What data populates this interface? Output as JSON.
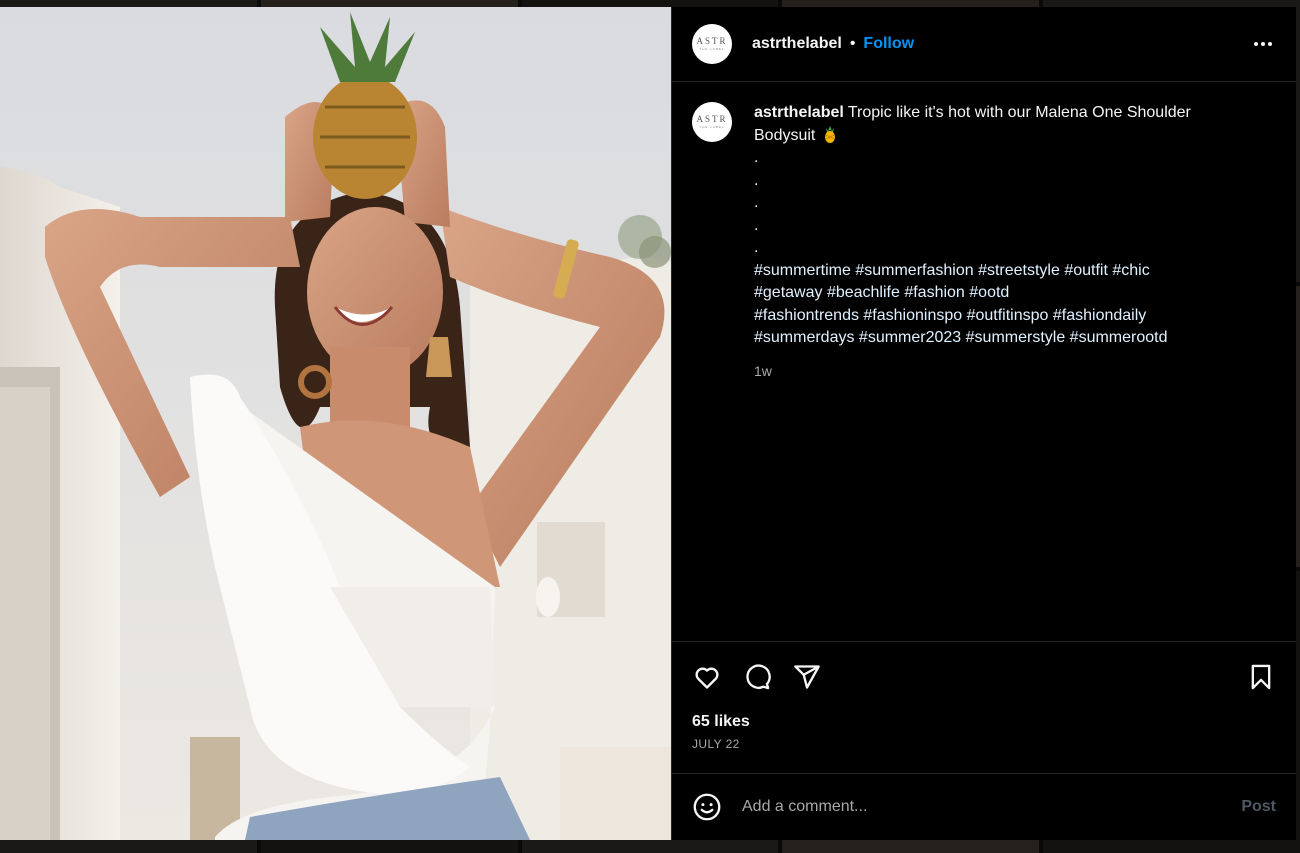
{
  "post": {
    "username": "astrthelabel",
    "separator": "•",
    "follow_label": "Follow",
    "avatar_text": "ASTR",
    "avatar_subtext": "THE LABEL",
    "caption_user": "astrthelabel",
    "caption_text": "Tropic like it's hot with our Malena One Shoulder Bodysuit",
    "caption_emoji": "pineapple",
    "caption_dots": [
      ".",
      ".",
      ".",
      ".",
      "."
    ],
    "hashtag_lines": [
      "#summertime #summerfashion #streetstyle #outfit #chic",
      "#getaway #beachlife #fashion #ootd",
      "#fashiontrends #fashioninspo #outfitinspo #fashiondaily",
      "#summerdays #summer2023 #summerstyle #summerootd"
    ],
    "time_ago": "1w",
    "likes": "65 likes",
    "date": "JULY 22"
  },
  "comment": {
    "placeholder": "Add a comment...",
    "post_label": "Post"
  },
  "icons": {
    "more": "more-options-icon",
    "like": "heart-icon",
    "comment": "comment-icon",
    "share": "share-icon",
    "save": "bookmark-icon",
    "emoji": "emoji-icon"
  },
  "colors": {
    "accent": "#0095f6",
    "background": "#000000",
    "muted": "#a8a8a8",
    "post_disabled": "#4f5863"
  }
}
